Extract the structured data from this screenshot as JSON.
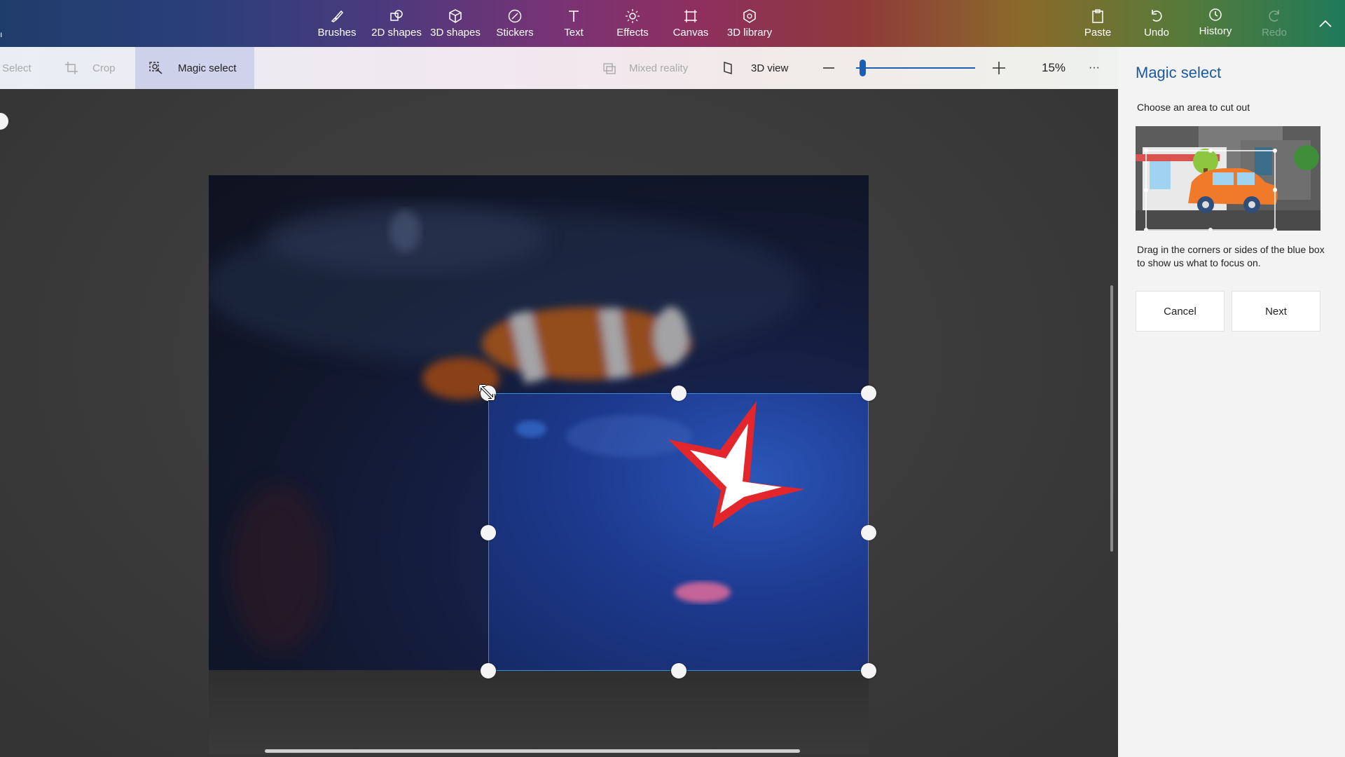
{
  "ribbon": {
    "tools": [
      {
        "label": "Brushes",
        "icon": "brush-icon"
      },
      {
        "label": "2D shapes",
        "icon": "2d-shapes-icon"
      },
      {
        "label": "3D shapes",
        "icon": "3d-shapes-icon"
      },
      {
        "label": "Stickers",
        "icon": "sticker-icon"
      },
      {
        "label": "Text",
        "icon": "text-icon"
      },
      {
        "label": "Effects",
        "icon": "effects-icon"
      },
      {
        "label": "Canvas",
        "icon": "canvas-icon"
      },
      {
        "label": "3D library",
        "icon": "3d-library-icon"
      }
    ],
    "actions": [
      {
        "label": "Paste",
        "icon": "paste-icon",
        "enabled": true
      },
      {
        "label": "Undo",
        "icon": "undo-icon",
        "enabled": true
      },
      {
        "label": "History",
        "icon": "history-icon",
        "enabled": true
      },
      {
        "label": "Redo",
        "icon": "redo-icon",
        "enabled": false
      }
    ]
  },
  "toolbar": {
    "select_label": "Select",
    "crop_label": "Crop",
    "magic_select_label": "Magic select",
    "mixed_reality_label": "Mixed reality",
    "view_3d_label": "3D view",
    "zoom_level": "15%",
    "zoom_slider_fraction": 0.03,
    "more_label": "···"
  },
  "panel": {
    "title": "Magic select",
    "subtitle": "Choose an area to cut out",
    "description": "Drag in the corners or sides of the blue box to show us what to focus on.",
    "cancel_label": "Cancel",
    "next_label": "Next"
  },
  "colors": {
    "accent": "#1a5aa0",
    "selection_border": "#3a8bd8",
    "panel_bg": "#f3f3f3"
  }
}
